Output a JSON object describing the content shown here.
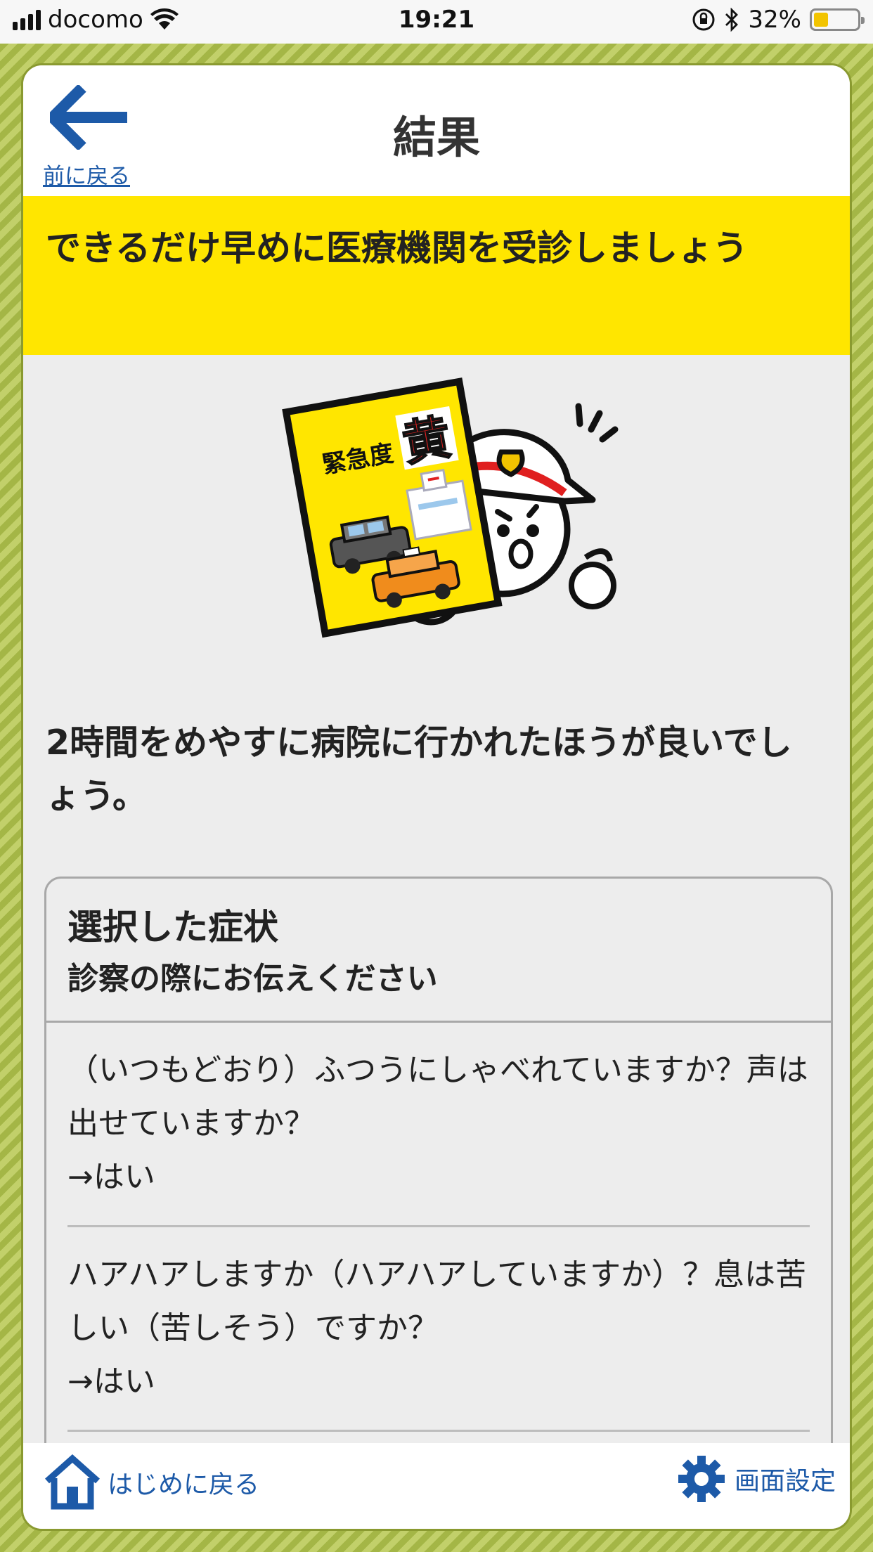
{
  "status_bar": {
    "carrier": "docomo",
    "time": "19:21",
    "battery_percent": "32%",
    "battery_level": 0.32,
    "icons": [
      "signal-icon",
      "wifi-icon",
      "rotation-lock-icon",
      "bluetooth-icon",
      "battery-icon"
    ]
  },
  "header": {
    "back_label": "前に戻る",
    "title": "結果"
  },
  "banner": {
    "text": "できるだけ早めに医療機関を受診しましょう"
  },
  "illustration": {
    "sign_label": "緊急度",
    "sign_level": "黄"
  },
  "advice": {
    "text": "2時間をめやすに病院に行かれたほうが良いでしょう。"
  },
  "symptoms": {
    "title": "選択した症状",
    "subtitle": "診察の際にお伝えください",
    "items": [
      {
        "question": "（いつもどおり）ふつうにしゃべれていますか？声は出せていますか？",
        "answer": "→はい"
      },
      {
        "question": "ハアハアしますか（ハアハアしていますか）？息は苦しい（苦しそう）ですか？",
        "answer": "→はい"
      }
    ]
  },
  "footer": {
    "home_label": "はじめに戻る",
    "settings_label": "画面設定"
  },
  "colors": {
    "accent_blue": "#1d5aa8",
    "banner_yellow": "#ffe600",
    "frame_green": "#a4b646"
  }
}
